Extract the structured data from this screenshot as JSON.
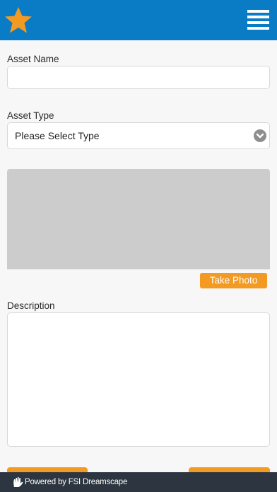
{
  "header": {
    "logo_icon": "star-icon",
    "menu_icon": "hamburger-menu-icon",
    "background": "#0a7cc5",
    "star_color": "#f39a23"
  },
  "form": {
    "asset_name_label": "Asset Name",
    "asset_name_value": "",
    "asset_type_label": "Asset Type",
    "asset_type_selected": "Please Select Type",
    "take_photo_label": "Take Photo",
    "description_label": "Description",
    "description_value": ""
  },
  "footer": {
    "text": "Powered by FSI Dreamscape",
    "logo_icon": "fsi-hand-logo-icon"
  },
  "colors": {
    "accent": "#f39a23",
    "photo_placeholder": "#cccccc",
    "footer_bg": "#2c3540"
  }
}
